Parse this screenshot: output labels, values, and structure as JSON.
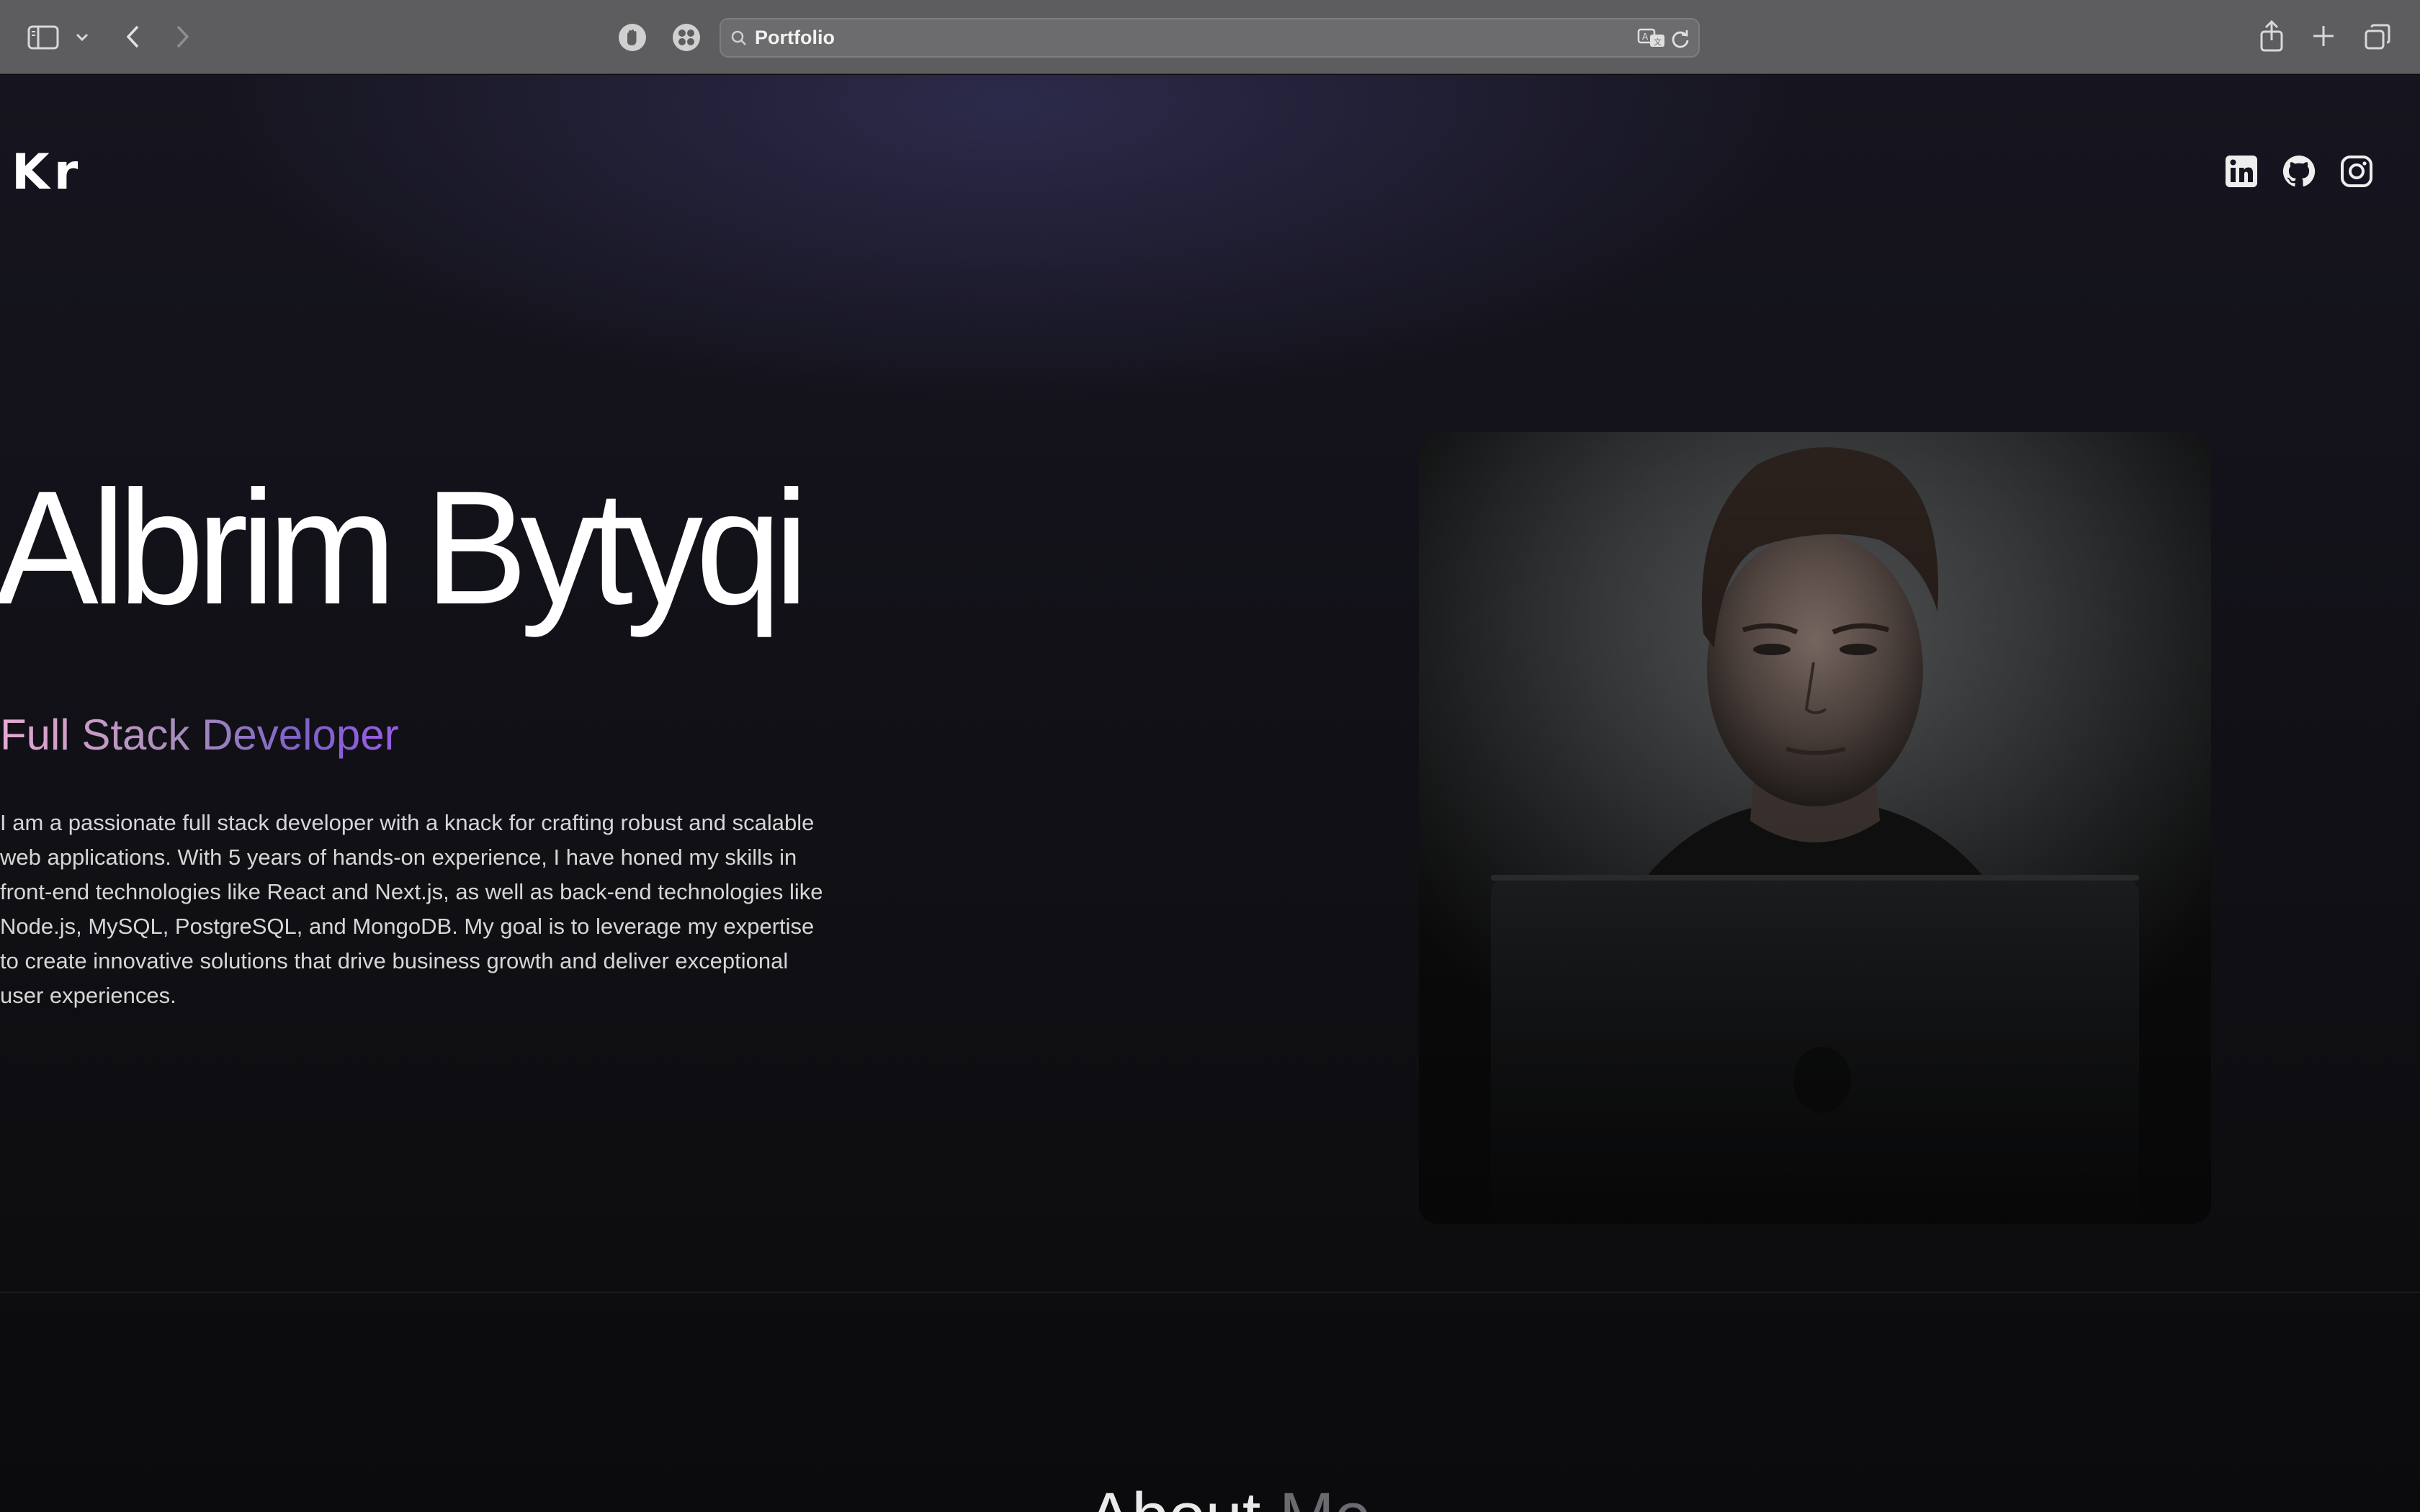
{
  "browser": {
    "address": "Portfolio",
    "icons": {
      "sidebar": "sidebar-icon",
      "sidebar_menu": "chevron-down-icon",
      "back": "chevron-left-icon",
      "forward": "chevron-right-icon",
      "extension_1": "shield-hand-icon",
      "extension_2": "puzzle-extension-icon",
      "search": "search-icon",
      "translate": "translate-icon",
      "reload": "reload-icon",
      "share": "share-icon",
      "new_tab": "plus-icon",
      "tabs_overview": "tabs-overview-icon"
    }
  },
  "site": {
    "logo": "Kr",
    "social": [
      "linkedin-icon",
      "github-icon",
      "instagram-icon"
    ],
    "hero": {
      "name": "Albrim Bytyqi",
      "role": "Full Stack Developer",
      "bio": "I am a passionate full stack developer with a knack for crafting robust and scalable web applications. With 5 years of hands-on experience, I have honed my skills in front-end technologies like React and Next.js, as well as back-end technologies like Node.js, MySQL, PostgreSQL, and MongoDB. My goal is to leverage my expertise to create innovative solutions that drive business growth and deliver exceptional user experiences."
    },
    "next_section": {
      "heading_main": "About ",
      "heading_accent": "Me"
    }
  },
  "colors": {
    "toolbar": "#5d5d5f",
    "page_bg": "#0b0b0d",
    "role_gradient_start": "#e6a9d2",
    "role_gradient_end": "#9a5de6"
  }
}
